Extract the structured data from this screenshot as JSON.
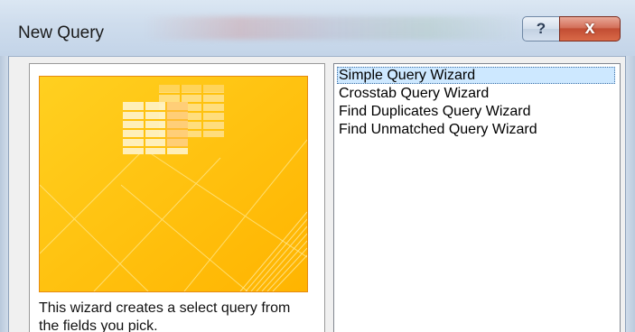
{
  "window": {
    "title": "New Query",
    "help_label": "?",
    "close_label": "x"
  },
  "preview": {
    "description": "This wizard creates a select query from the fields you pick."
  },
  "query_list": {
    "items": [
      {
        "label": "Simple Query Wizard",
        "selected": true
      },
      {
        "label": "Crosstab Query Wizard",
        "selected": false
      },
      {
        "label": "Find Duplicates Query Wizard",
        "selected": false
      },
      {
        "label": "Find Unmatched Query Wizard",
        "selected": false
      }
    ]
  },
  "colors": {
    "preview_background": "#ffc20e",
    "preview_border": "#e58a10",
    "selection_background": "#cde8ff",
    "close_button": "#c24d33"
  }
}
